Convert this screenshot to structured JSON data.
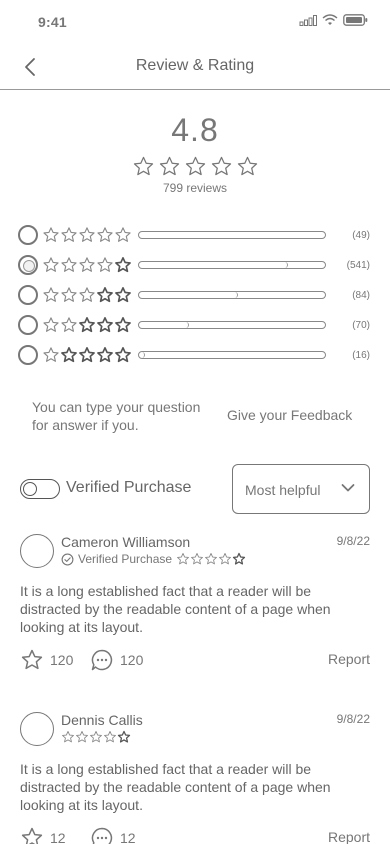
{
  "status": {
    "time": "9:41"
  },
  "header": {
    "title": "Review & Rating"
  },
  "summary": {
    "average": "4.8",
    "reviews_label": "799 reviews"
  },
  "distribution": [
    {
      "stars": 5,
      "count": "(49)",
      "fraction": 0.0,
      "selected": false
    },
    {
      "stars": 4,
      "count": "(541)",
      "fraction": 0.8,
      "selected": true
    },
    {
      "stars": 3,
      "count": "(84)",
      "fraction": 0.53,
      "selected": false
    },
    {
      "stars": 2,
      "count": "(70)",
      "fraction": 0.27,
      "selected": false
    },
    {
      "stars": 1,
      "count": "(16)",
      "fraction": 0.03,
      "selected": false
    }
  ],
  "feedback": {
    "hint": "You can type your question for answer if you.",
    "link": "Give your Feedback"
  },
  "filters": {
    "verified_label": "Verified Purchase",
    "sort_value": "Most helpful"
  },
  "reviews": [
    {
      "name": "Cameron Williamson",
      "date": "9/8/22",
      "verified_label": "Verified Purchase",
      "text": "It is a long established fact that a reader will be distracted by the readable content of a page when looking at its layout.",
      "likes": "120",
      "comments": "120",
      "report": "Report"
    },
    {
      "name": "Dennis Callis",
      "date": "9/8/22",
      "text": "It is a long established fact that a reader will be distracted by the readable content of a page when looking at its layout.",
      "likes": "12",
      "comments": "12",
      "report": "Report"
    }
  ]
}
